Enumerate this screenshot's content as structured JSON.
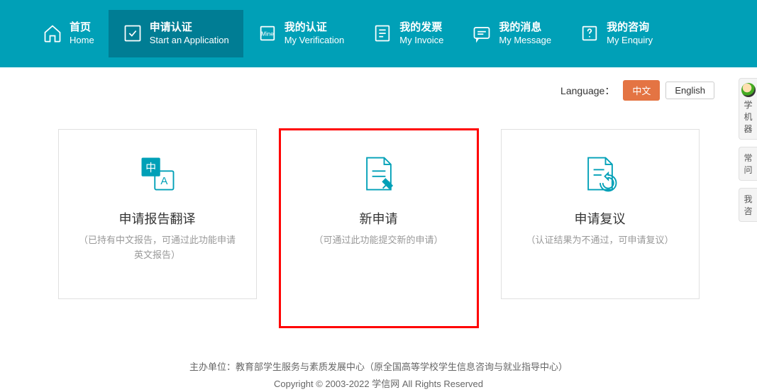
{
  "nav": [
    {
      "cn": "首页",
      "en": "Home"
    },
    {
      "cn": "申请认证",
      "en": "Start an Application"
    },
    {
      "cn": "我的认证",
      "en": "My Verification"
    },
    {
      "cn": "我的发票",
      "en": "My Invoice"
    },
    {
      "cn": "我的消息",
      "en": "My Message"
    },
    {
      "cn": "我的咨询",
      "en": "My Enquiry"
    }
  ],
  "lang": {
    "label": "Language：",
    "cn": "中文",
    "en": "English"
  },
  "cards": [
    {
      "title": "申请报告翻译",
      "desc": "（已持有中文报告，可通过此功能申请英文报告）"
    },
    {
      "title": "新申请",
      "desc": "（可通过此功能提交新的申请）"
    },
    {
      "title": "申请复议",
      "desc": "（认证结果为不通过，可申请复议）"
    }
  ],
  "footer": {
    "line1": "主办单位：教育部学生服务与素质发展中心（原全国高等学校学生信息咨询与就业指导中心）",
    "line2": "Copyright © 2003-2022 学信网 All Rights Reserved"
  },
  "side": {
    "bot1": "学",
    "bot2": "机器",
    "faq1": "常",
    "faq2": "问",
    "consult1": "我",
    "consult2": "咨"
  }
}
